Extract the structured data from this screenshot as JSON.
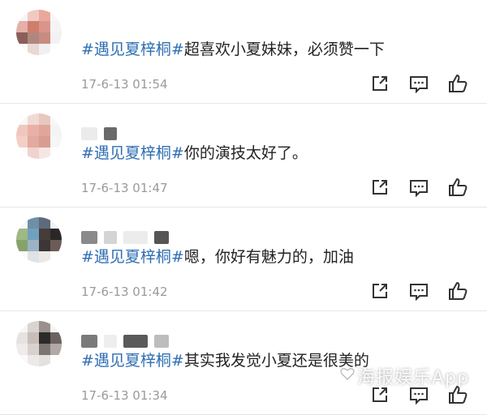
{
  "comments": [
    {
      "topic": "#遇见夏梓桐#",
      "body": "超喜欢小夏妹妹，必须赞一下",
      "time": "17-6-13 01:54",
      "avatar_colors": [
        "#f6f6f6",
        "#f2c9c1",
        "#e9a89a",
        "#f7f7f7",
        "#e4b0a8",
        "#cf7d6d",
        "#d9958a",
        "#f4f4f4",
        "#8a5f5a",
        "#b0877f",
        "#c98b80",
        "#f2f2f2",
        "#fafafa",
        "#e9d8d4",
        "#f1f1f1",
        "#fefefe"
      ],
      "name_colors": []
    },
    {
      "topic": "#遇见夏梓桐#",
      "body": "你的演技太好了。",
      "time": "17-6-13 01:47",
      "avatar_colors": [
        "#f7f7f7",
        "#f1d9d4",
        "#e8c7c1",
        "#f8f8f8",
        "#f0c7bf",
        "#e8b1a8",
        "#e1a69a",
        "#f4f4f4",
        "#f3cfc8",
        "#e3aa9f",
        "#d99c90",
        "#f6f6f6",
        "#fbfbfb",
        "#f1d3cd",
        "#f6e6e3",
        "#fefefe"
      ],
      "name_colors": [
        "#ebebeb",
        "#6a6a6a"
      ]
    },
    {
      "topic": "#遇见夏梓桐#",
      "body": "嗯，你好有魅力的，加油",
      "time": "17-6-13 01:42",
      "avatar_colors": [
        "#f7f7f7",
        "#6f8fa7",
        "#5c6b79",
        "#f3f3f3",
        "#9fb884",
        "#71a0bf",
        "#463c3a",
        "#2b2727",
        "#86a36a",
        "#9bb3c4",
        "#3c3636",
        "#6c5c57",
        "#fafafa",
        "#dfe3e6",
        "#ece8e6",
        "#fdfdfd"
      ],
      "name_colors": [
        "#8a8a8a",
        "#d4d4d4",
        "#ececec",
        "#555555"
      ]
    },
    {
      "topic": "#遇见夏梓桐#",
      "body": "其实我发觉小夏还是很美的",
      "time": "17-6-13 01:34",
      "avatar_colors": [
        "#f6f6f6",
        "#d9d3d1",
        "#9b908c",
        "#f4f4f4",
        "#e7e2e0",
        "#c7beba",
        "#2d2a29",
        "#6a6361",
        "#efebea",
        "#d8d1ce",
        "#7d7572",
        "#b0a9a6",
        "#fafafa",
        "#ece9e8",
        "#e4e1df",
        "#fefefe"
      ],
      "name_colors": [
        "#7a7a7a",
        "#eeeeee",
        "#5a5a5a",
        "#bdbdbd"
      ]
    }
  ],
  "actions": {
    "share_icon": "share-icon",
    "comment_icon": "comment-icon",
    "like_icon": "like-icon",
    "icon_color": "#333333"
  },
  "watermark": "海报娱乐App"
}
